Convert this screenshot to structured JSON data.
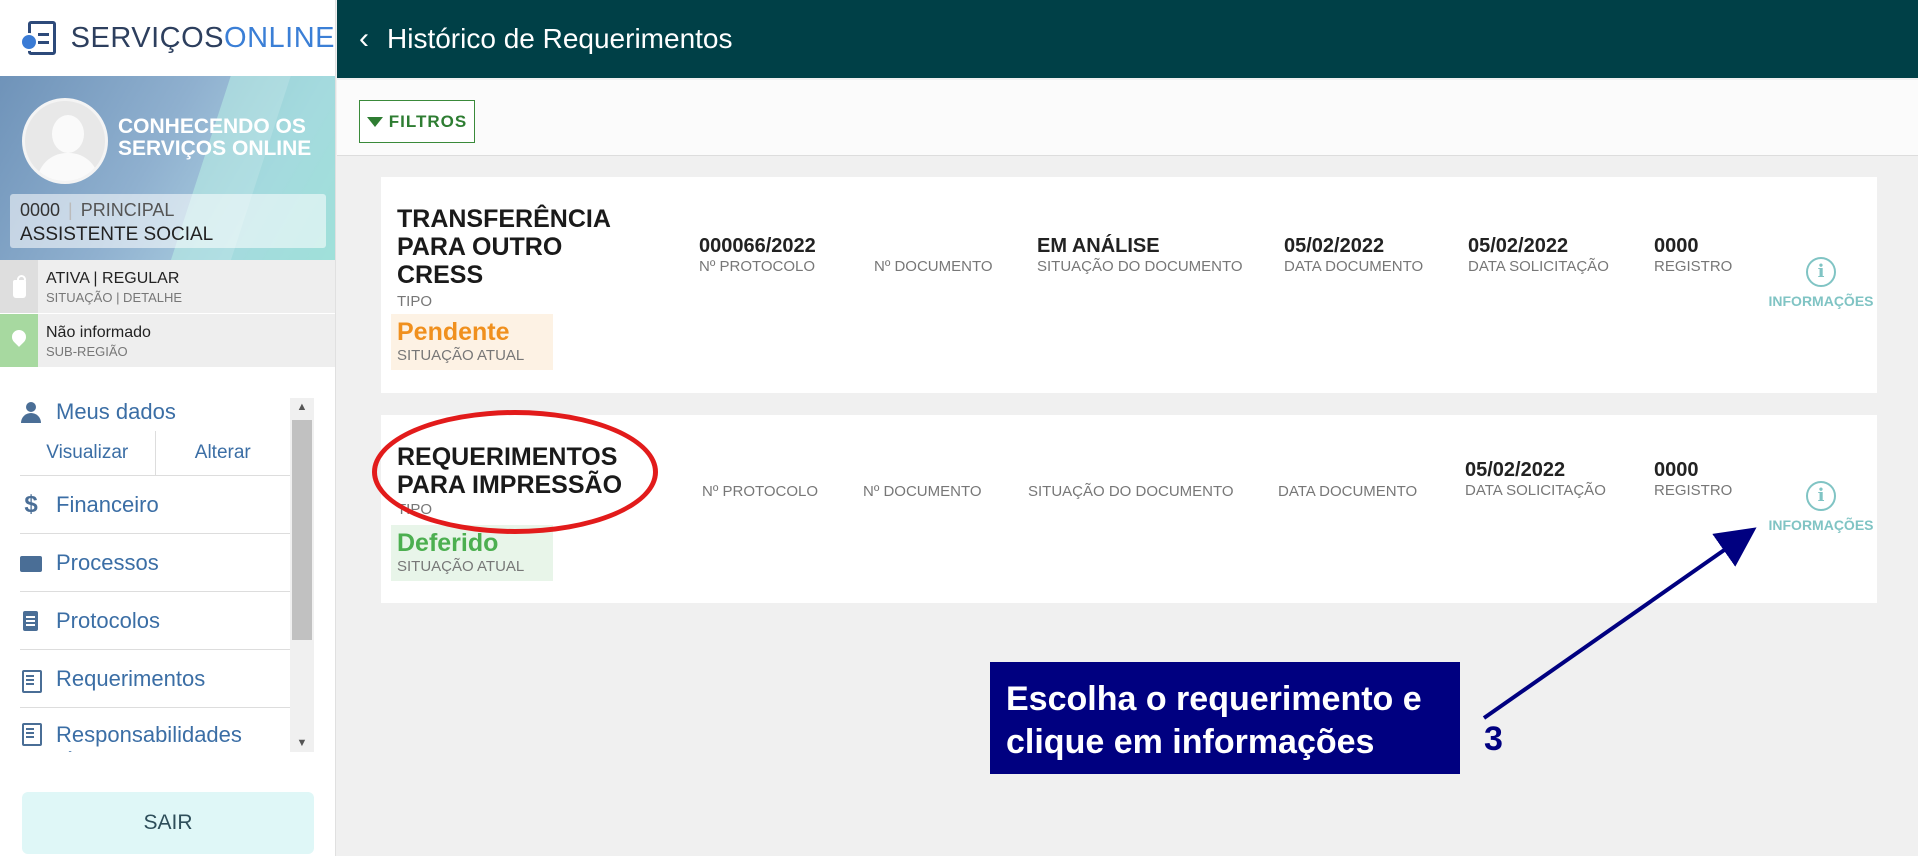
{
  "logo": {
    "part1": "SERVIÇOS",
    "part2": "ONLINE"
  },
  "profile": {
    "name": "CONHECENDO OS SERVIÇOS ONLINE",
    "code": "0000",
    "type": "PRINCIPAL",
    "role": "ASSISTENTE SOCIAL"
  },
  "status": {
    "situation": "ATIVA | REGULAR",
    "situation_label": "SITUAÇÃO | DETALHE",
    "region": "Não informado",
    "region_label": "SUB-REGIÃO"
  },
  "menu": {
    "meus_dados": "Meus dados",
    "visualizar": "Visualizar",
    "alterar": "Alterar",
    "items": [
      "Financeiro",
      "Processos",
      "Protocolos",
      "Requerimentos",
      "Responsabilidades técnicas"
    ],
    "logout": "SAIR"
  },
  "header": {
    "title": "Histórico de Requerimentos"
  },
  "filter": {
    "label": "FILTROS"
  },
  "labels": {
    "tipo": "TIPO",
    "situacao_atual": "SITUAÇÃO ATUAL",
    "protocolo": "Nº PROTOCOLO",
    "documento": "Nº DOCUMENTO",
    "situacao_documento": "SITUAÇÃO DO DOCUMENTO",
    "data_documento": "DATA DOCUMENTO",
    "data_solicitacao": "DATA SOLICITAÇÃO",
    "registro": "REGISTRO",
    "informacoes": "INFORMAÇÕES"
  },
  "requests": [
    {
      "tipo_lines": [
        "TRANSFERÊNCIA",
        "PARA OUTRO",
        "CRESS"
      ],
      "situacao": "Pendente",
      "protocolo": "000066/2022",
      "situacao_documento": "EM ANÁLISE",
      "data_documento": "05/02/2022",
      "data_solicitacao": "05/02/2022",
      "registro": "0000"
    },
    {
      "tipo_lines": [
        "REQUERIMENTOS",
        "PARA IMPRESSÃO"
      ],
      "situacao": "Deferido",
      "data_solicitacao": "05/02/2022",
      "registro": "0000"
    }
  ],
  "callout": {
    "line1": "Escolha o requerimento e",
    "line2": "clique em informações",
    "step": "3"
  },
  "colors": {
    "header_bg": "#004047",
    "pending": "#f0901e",
    "approved": "#4caf50",
    "callout_bg": "#000080",
    "highlight": "#e21b1b"
  }
}
